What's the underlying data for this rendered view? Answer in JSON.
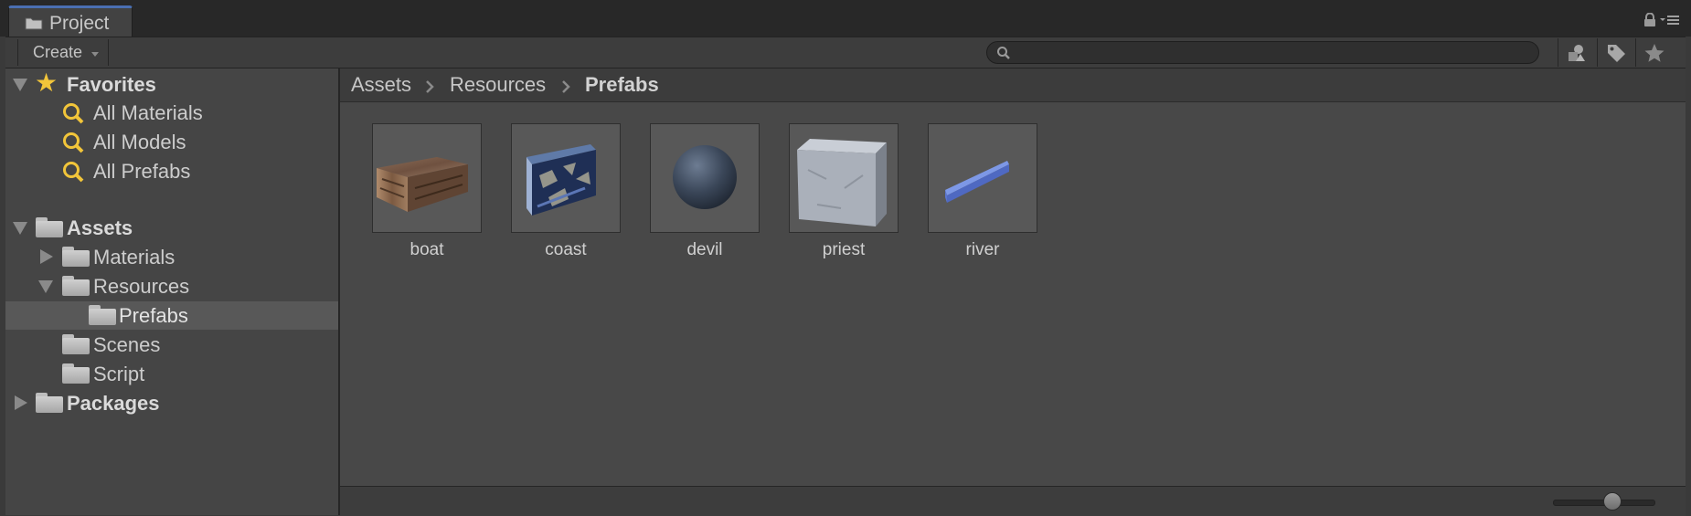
{
  "tab": {
    "title": "Project",
    "icon": "folder-icon"
  },
  "toolbar": {
    "create_label": "Create",
    "search": {
      "value": "",
      "placeholder": ""
    },
    "icons": [
      "search-by-type-icon",
      "label-icon",
      "favorite-star-icon"
    ]
  },
  "tree": {
    "favorites": {
      "label": "Favorites",
      "items": [
        {
          "label": "All Materials"
        },
        {
          "label": "All Models"
        },
        {
          "label": "All Prefabs"
        }
      ]
    },
    "assets": {
      "label": "Assets",
      "children": [
        {
          "label": "Materials",
          "expanded": false
        },
        {
          "label": "Resources",
          "expanded": true,
          "children": [
            {
              "label": "Prefabs",
              "selected": true
            }
          ]
        },
        {
          "label": "Scenes"
        },
        {
          "label": "Script"
        }
      ]
    },
    "packages": {
      "label": "Packages",
      "expanded": false
    }
  },
  "breadcrumb": [
    "Assets",
    "Resources",
    "Prefabs"
  ],
  "assets_grid": [
    {
      "name": "boat",
      "preview": "wooden-box"
    },
    {
      "name": "coast",
      "preview": "blue-stone-block"
    },
    {
      "name": "devil",
      "preview": "dark-sphere"
    },
    {
      "name": "priest",
      "preview": "grey-cube"
    },
    {
      "name": "river",
      "preview": "blue-bar"
    }
  ],
  "footer": {
    "zoom_slider_value": 0.55
  },
  "colors": {
    "accent_tab": "#4a6fb2",
    "favorite_star": "#f2c53a",
    "search_icon": "#f2c53a",
    "selection": "#585858"
  }
}
